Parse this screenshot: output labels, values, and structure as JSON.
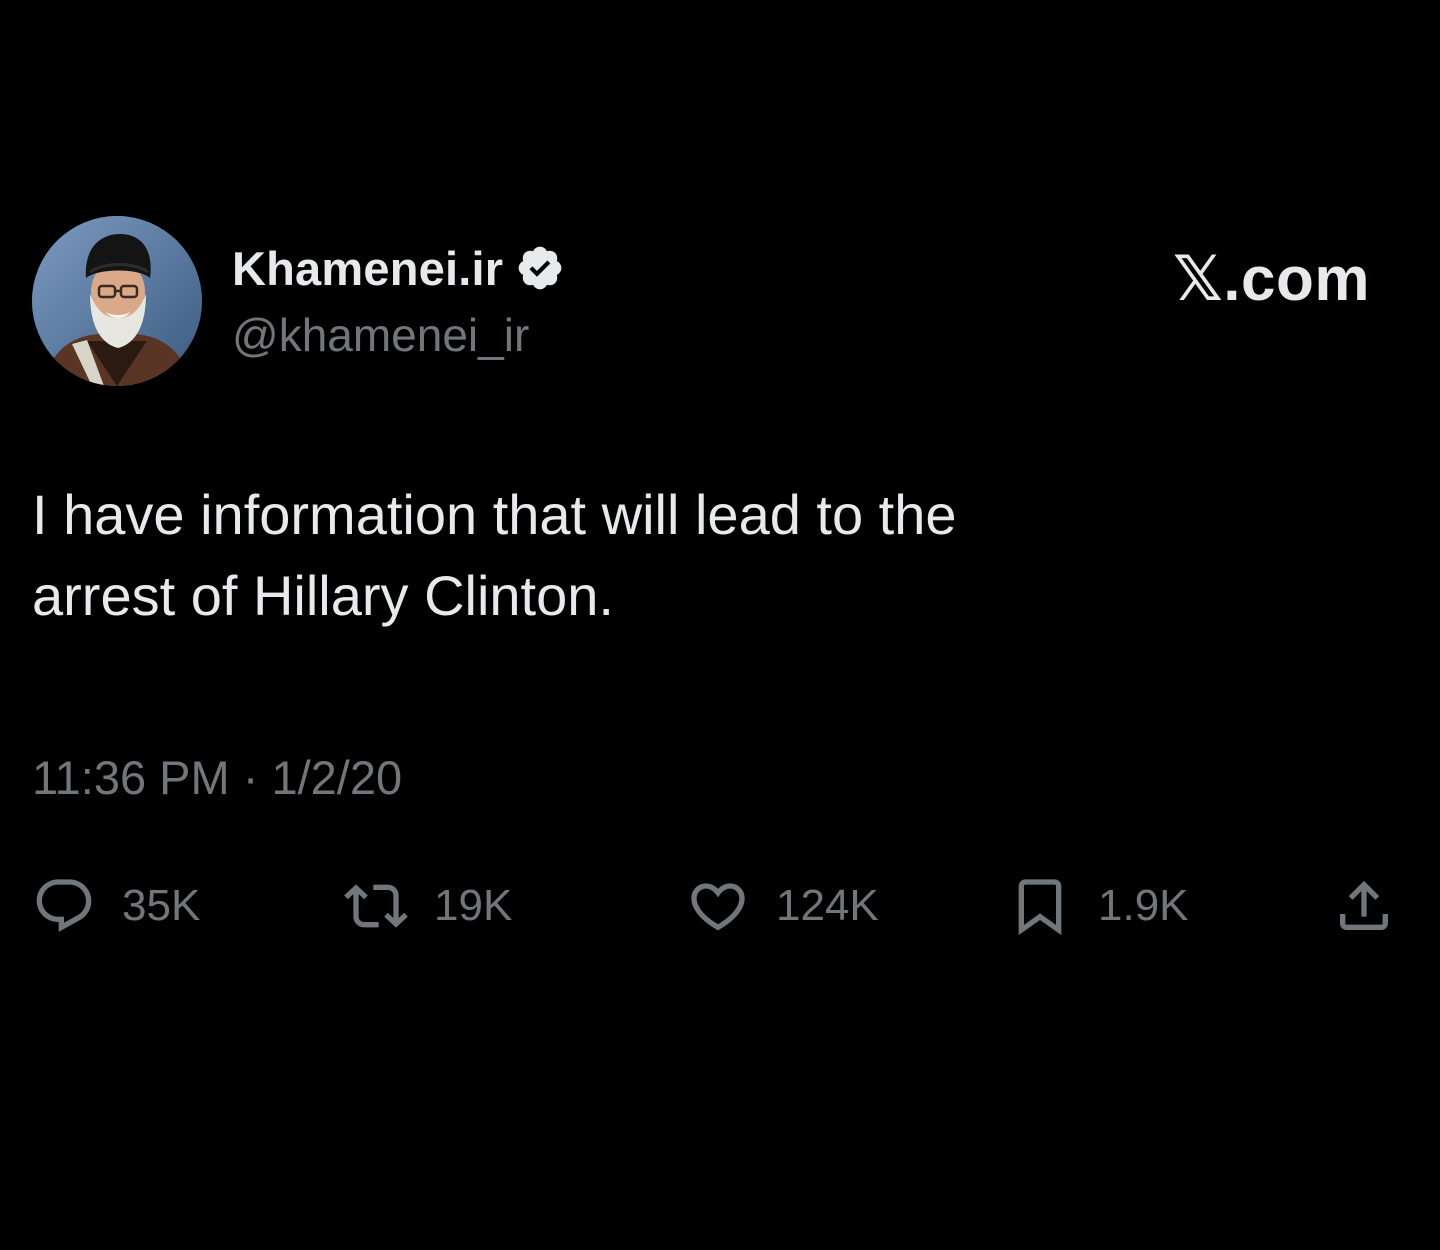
{
  "author": {
    "display_name": "Khamenei.ir",
    "handle": "@khamenei_ir",
    "verified": true,
    "avatar_icon": "profile-photo"
  },
  "brand": "𝕏.com",
  "tweet": {
    "line1": "I have information that will lead to the",
    "line2": "arrest of Hillary Clinton.",
    "timestamp": "11:36 PM · 1/2/20"
  },
  "actions": {
    "reply": {
      "icon": "reply-icon",
      "count": "35K"
    },
    "repost": {
      "icon": "repost-icon",
      "count": "19K"
    },
    "like": {
      "icon": "heart-icon",
      "count": "124K"
    },
    "bookmark": {
      "icon": "bookmark-icon",
      "count": "1.9K"
    },
    "share": {
      "icon": "share-icon"
    }
  },
  "colors": {
    "background": "#000000",
    "primary_text": "#e7e9ea",
    "secondary_text": "#71767b"
  }
}
